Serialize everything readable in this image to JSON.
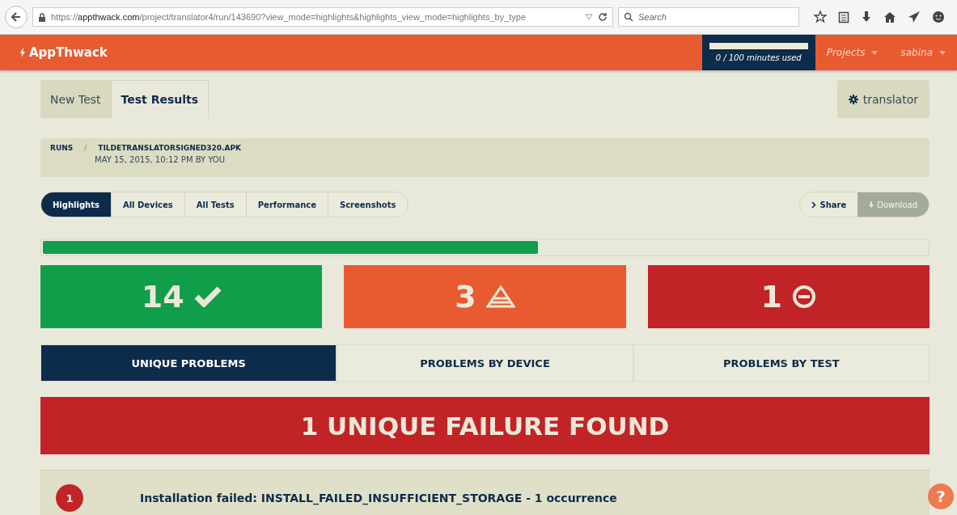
{
  "browser": {
    "url_host": "appthwack.com",
    "url_path": "/project/translator4/run/143690?view_mode=highlights&highlights_view_mode=highlights_by_type",
    "url_scheme": "https://",
    "search": {
      "placeholder": "Search"
    }
  },
  "app_bar": {
    "logo": "AppThwack",
    "usage": "0 / 100 minutes used",
    "menus": [
      {
        "label": "Projects"
      },
      {
        "label": "sabina"
      }
    ]
  },
  "tabs": [
    {
      "label": "New Test",
      "selected": false
    },
    {
      "label": "Test Results",
      "selected": true
    }
  ],
  "project_button": "translator",
  "breadcrumb": {
    "root": "RUNS",
    "separator": "/",
    "file": "TILDETRANSLATORSIGNED320.APK",
    "date": "MAY 15, 2015, 10:12 PM BY YOU"
  },
  "view_tabs": [
    {
      "label": "Highlights",
      "selected": true
    },
    {
      "label": "All Devices",
      "selected": false
    },
    {
      "label": "All Tests",
      "selected": false
    },
    {
      "label": "Performance",
      "selected": false
    },
    {
      "label": "Screenshots",
      "selected": false
    }
  ],
  "actions": [
    {
      "label": "Share",
      "disabled": false
    },
    {
      "label": "Download",
      "disabled": true
    }
  ],
  "progress": {
    "level": 0.56
  },
  "stats": [
    {
      "kind": "passed",
      "count": "14"
    },
    {
      "kind": "warning",
      "count": "3"
    },
    {
      "kind": "failed",
      "count": "1"
    }
  ],
  "problem_tabs": [
    {
      "label": "UNIQUE PROBLEMS",
      "selected": true
    },
    {
      "label": "PROBLEMS BY DEVICE",
      "selected": false
    },
    {
      "label": "PROBLEMS BY TEST",
      "selected": false
    }
  ],
  "banner": "1 UNIQUE FAILURE FOUND",
  "problems": [
    {
      "number": "1",
      "text": "Installation failed: INSTALL_FAILED_INSUFFICIENT_STORAGE - 1 occurrence"
    }
  ],
  "help": "?"
}
